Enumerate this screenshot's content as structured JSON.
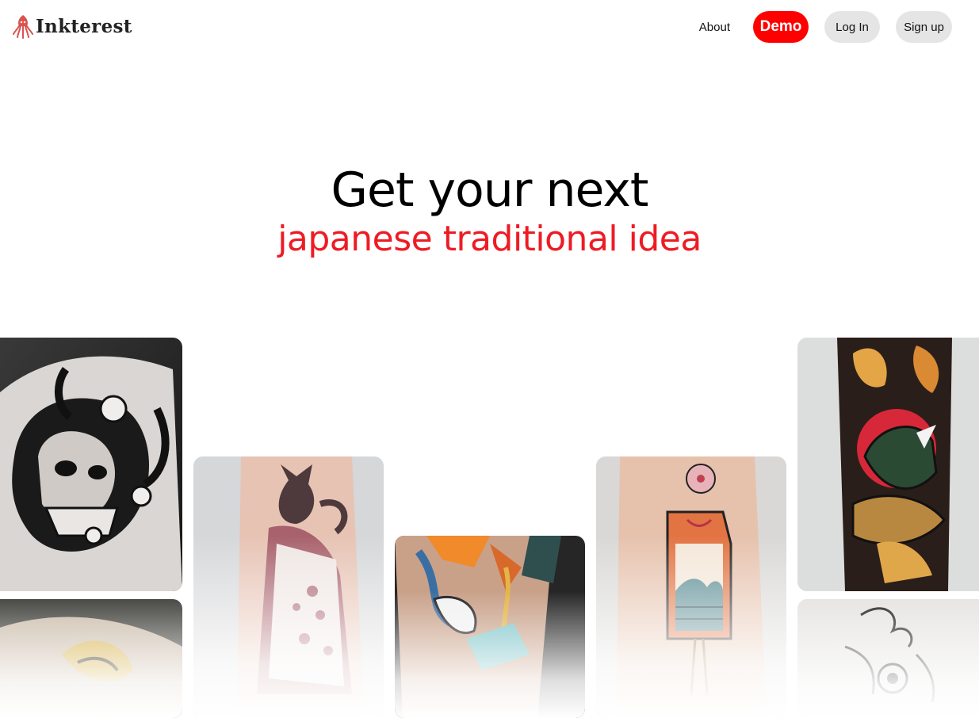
{
  "header": {
    "logo_text": "Inkterest",
    "logo_icon": "squid-icon",
    "nav": {
      "about_label": "About",
      "demo_label": "Demo",
      "login_label": "Log In",
      "signup_label": "Sign up"
    }
  },
  "hero": {
    "line1": "Get your next",
    "line2": "japanese traditional idea"
  },
  "gallery": {
    "items": [
      {
        "subject": "hannya-mask-tattoo"
      },
      {
        "subject": "koi-fish-tattoo"
      },
      {
        "subject": "geisha-cat-tattoo"
      },
      {
        "subject": "crane-tiger-tattoo"
      },
      {
        "subject": "omamori-wave-tattoo"
      },
      {
        "subject": "snake-tattoo"
      },
      {
        "subject": "wave-fish-tattoo"
      }
    ]
  },
  "colors": {
    "accent": "#ff0000",
    "hero_highlight": "#ee1b24",
    "pill_gray": "#e5e5e5",
    "logo_icon": "#d9534f"
  }
}
